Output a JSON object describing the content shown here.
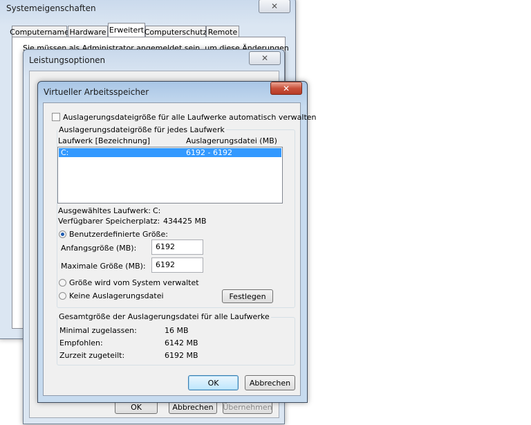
{
  "sys_window": {
    "title": "Systemeigenschaften",
    "tabs": [
      "Computername",
      "Hardware",
      "Erweitert",
      "Computerschutz",
      "Remote"
    ],
    "active_tab": "Erweitert",
    "notice": "Sie müssen als Administrator angemeldet sein, um diese Änderungen",
    "close_label": "✕"
  },
  "perf_window": {
    "title": "Leistungsoptionen",
    "close_label": "✕",
    "buttons": {
      "ok": "OK",
      "cancel": "Abbrechen",
      "apply": "Übernehmen"
    }
  },
  "vm_dialog": {
    "title": "Virtueller Arbeitsspeicher",
    "close_label": "✕",
    "auto_manage_label": "Auslagerungsdateigröße für alle Laufwerke automatisch verwalten",
    "auto_manage_checked": false,
    "per_drive_group": "Auslagerungsdateigröße für jedes Laufwerk",
    "list_headers": {
      "drive": "Laufwerk [Bezeichnung]",
      "size": "Auslagerungsdatei (MB)"
    },
    "drives": [
      {
        "drive": "C:",
        "size": "6192 - 6192",
        "selected": true
      }
    ],
    "selected_drive_label": "Ausgewähltes Laufwerk:",
    "selected_drive_value": "C:",
    "free_space_label": "Verfügbarer Speicherplatz:",
    "free_space_value": "434425 MB",
    "custom_size_label": "Benutzerdefinierte Größe:",
    "initial_size_label": "Anfangsgröße (MB):",
    "initial_size_value": "6192",
    "max_size_label": "Maximale Größe (MB):",
    "max_size_value": "6192",
    "system_managed_label": "Größe wird vom System verwaltet",
    "no_paging_label": "Keine Auslagerungsdatei",
    "selected_option": "custom",
    "set_button": "Festlegen",
    "totals_group": "Gesamtgröße der Auslagerungsdatei für alle Laufwerke",
    "min_allowed_label": "Minimal zugelassen:",
    "min_allowed_value": "16 MB",
    "recommended_label": "Empfohlen:",
    "recommended_value": "6142 MB",
    "allocated_label": "Zurzeit zugeteilt:",
    "allocated_value": "6192 MB",
    "ok_button": "OK",
    "cancel_button": "Abbrechen"
  }
}
